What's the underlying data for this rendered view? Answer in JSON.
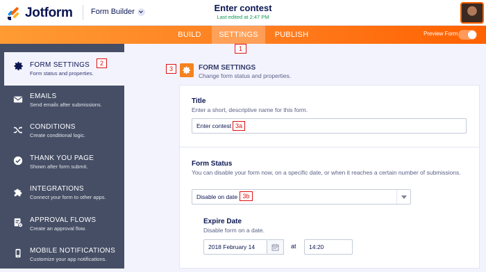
{
  "header": {
    "brand": "Jotform",
    "builder_menu": "Form Builder",
    "form_title": "Enter contest",
    "last_edited": "Last edited at 2:47 PM"
  },
  "nav": {
    "tabs": [
      "BUILD",
      "SETTINGS",
      "PUBLISH"
    ],
    "active_tab": "SETTINGS",
    "preview_label": "Preview Form"
  },
  "annotations": {
    "settings_tab": "1",
    "form_settings_item": "2",
    "form_settings_header": "3",
    "title_input": "3a",
    "status_select": "3b"
  },
  "sidebar": {
    "items": [
      {
        "label": "FORM SETTINGS",
        "desc": "Form status and properties.",
        "icon": "gear-icon"
      },
      {
        "label": "EMAILS",
        "desc": "Send emails after submissions.",
        "icon": "envelope-icon"
      },
      {
        "label": "CONDITIONS",
        "desc": "Create conditional logic.",
        "icon": "shuffle-icon"
      },
      {
        "label": "THANK YOU PAGE",
        "desc": "Shown after form submit.",
        "icon": "check-circle-icon"
      },
      {
        "label": "INTEGRATIONS",
        "desc": "Connect your form to other apps.",
        "icon": "puzzle-icon"
      },
      {
        "label": "APPROVAL FLOWS",
        "desc": "Create an approval flow.",
        "icon": "approval-icon"
      },
      {
        "label": "MOBILE NOTIFICATIONS",
        "desc": "Customize your app notifications.",
        "icon": "mobile-icon"
      }
    ]
  },
  "main": {
    "section_title": "FORM SETTINGS",
    "section_desc": "Change form status and properties.",
    "title_label": "Title",
    "title_desc": "Enter a short, descriptive name for this form.",
    "title_value": "Enter contest",
    "status_label": "Form Status",
    "status_desc": "You can disable your form now, on a specific date, or when it reaches a certain number of submissions.",
    "status_value": "Disable on date",
    "expire_label": "Expire Date",
    "expire_desc": "Disable form on a date.",
    "expire_date": "2018 February 14",
    "at_label": "at",
    "expire_time": "14:20"
  },
  "colors": {
    "accent": "#ff6100",
    "sidebar_bg": "#454e65",
    "page_bg": "#f3f3fe",
    "annotation": "#dd1111"
  }
}
